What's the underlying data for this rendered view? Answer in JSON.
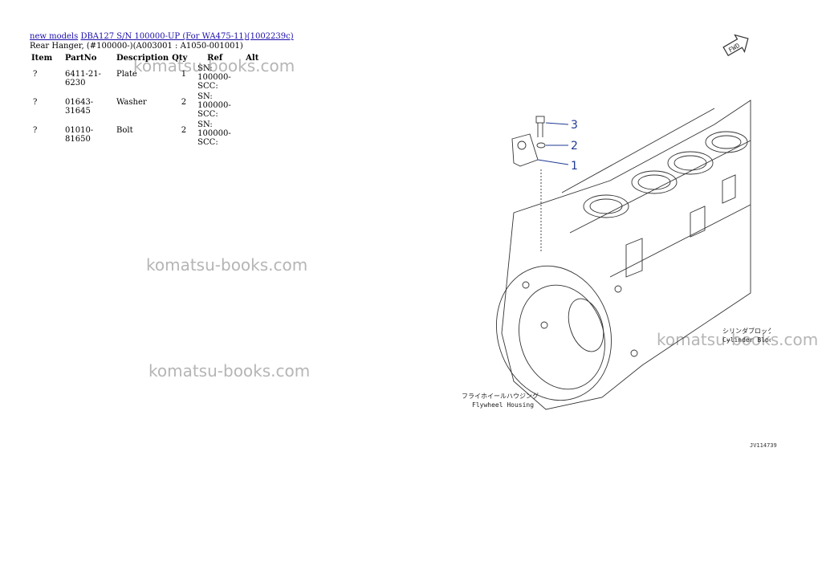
{
  "breadcrumb": {
    "home": "new models",
    "model": "DBA127 S/N 100000-UP (For WA475-11)(1002239c)"
  },
  "subtitle": "Rear Hanger, (#100000-)(A003001 : A1050-001001)",
  "table": {
    "headers": [
      "Item",
      "PartNo",
      "Description",
      "Qty",
      "Ref",
      "Alt"
    ],
    "rows": [
      {
        "item": "?",
        "part_no": "6411-21-6230",
        "description": "Plate",
        "qty": "1",
        "ref_line1": "SN: 100000-",
        "ref_line2": "SCC:",
        "alt": ""
      },
      {
        "item": "?",
        "part_no": "01643-31645",
        "description": "Washer",
        "qty": "2",
        "ref_line1": "SN: 100000-",
        "ref_line2": "SCC:",
        "alt": ""
      },
      {
        "item": "?",
        "part_no": "01010-81650",
        "description": "Bolt",
        "qty": "2",
        "ref_line1": "SN: 100000-",
        "ref_line2": "SCC:",
        "alt": ""
      }
    ]
  },
  "watermark": "komatsu-books.com",
  "diagram": {
    "callouts": [
      "3",
      "2",
      "1"
    ],
    "fwd_label": "FWD",
    "cylinder_block_jp": "シリンダブロック",
    "cylinder_block_en": "Cylinder Block",
    "flywheel_housing_jp": "フライホイールハウジング",
    "flywheel_housing_en": "Flywheel Housing",
    "drawing_number": "JV114739",
    "colors": {
      "callout": "#1f3a93",
      "line": "#333333"
    }
  }
}
